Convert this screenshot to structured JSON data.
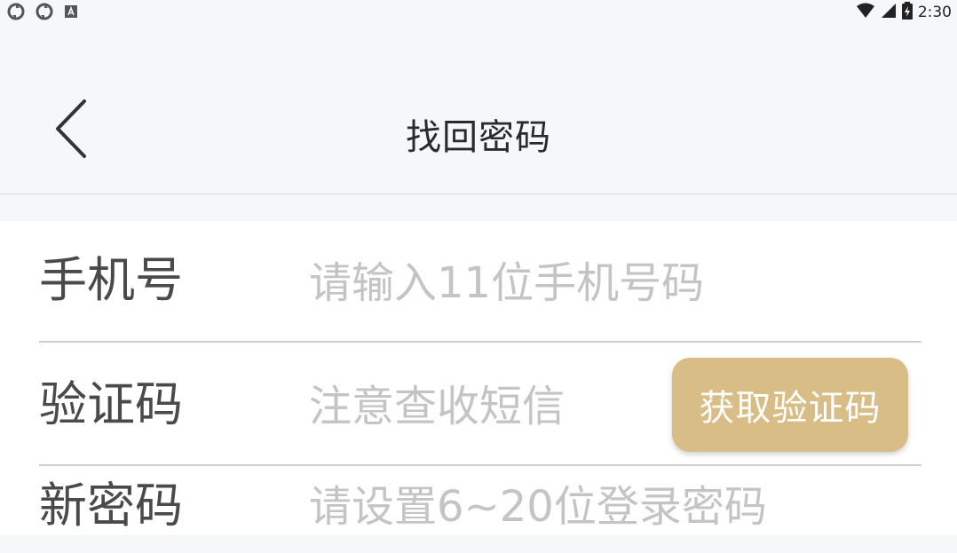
{
  "status_bar": {
    "time": "2:30",
    "icons": [
      "sync-icon",
      "sync-icon",
      "a-box-icon",
      "wifi-icon",
      "cell-signal-icon",
      "battery-charging-icon"
    ]
  },
  "header": {
    "title": "找回密码",
    "back_icon": "chevron-left-icon"
  },
  "form": {
    "phone": {
      "label": "手机号",
      "placeholder": "请输入11位手机号码"
    },
    "code": {
      "label": "验证码",
      "placeholder": "注意查收短信",
      "button_label": "获取验证码"
    },
    "new_password": {
      "label": "新密码",
      "placeholder": "请设置6~20位登录密码"
    }
  },
  "colors": {
    "accent": "#d8bd86",
    "background": "#f6f7f9",
    "placeholder": "#c4c4c4",
    "label": "#4a4a4a"
  }
}
